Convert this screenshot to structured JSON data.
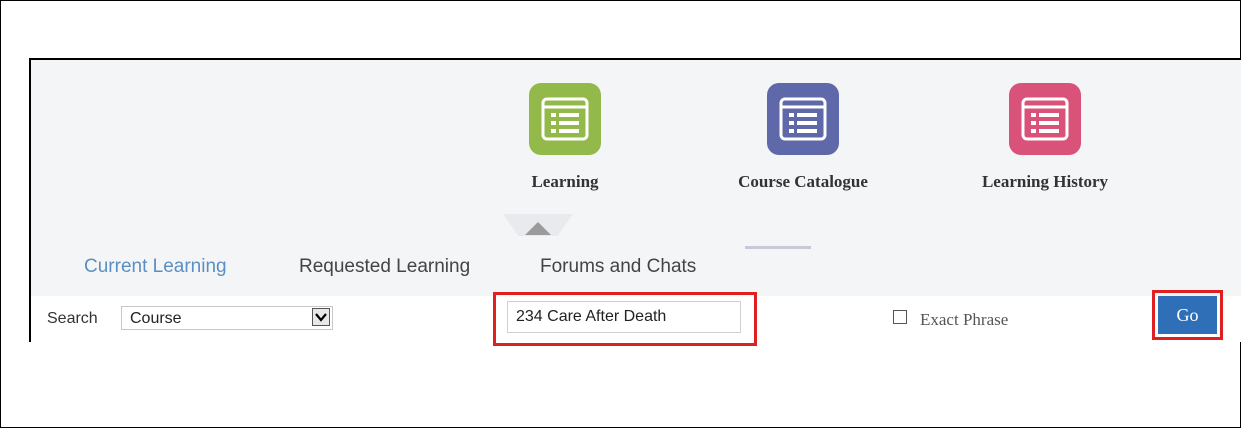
{
  "tiles": [
    {
      "label": "Learning",
      "icon": "course-list-icon",
      "color": "#93b94a"
    },
    {
      "label": "Course Catalogue",
      "icon": "course-list-icon",
      "color": "#5f68a8"
    },
    {
      "label": "Learning History",
      "icon": "course-list-icon",
      "color": "#d9527a"
    }
  ],
  "sub_tabs": [
    {
      "label": "Current Learning",
      "active": true
    },
    {
      "label": "Requested Learning",
      "active": false
    },
    {
      "label": "Forums and Chats",
      "active": false
    }
  ],
  "search": {
    "label": "Search",
    "category_selected": "Course",
    "query_value": "234 Care After Death",
    "exact_phrase_label": "Exact Phrase",
    "exact_phrase_checked": false,
    "go_label": "Go"
  },
  "colors": {
    "accent_blue": "#2f6fb7",
    "active_tab": "#5b8fc4",
    "highlight_red": "#e02020"
  }
}
